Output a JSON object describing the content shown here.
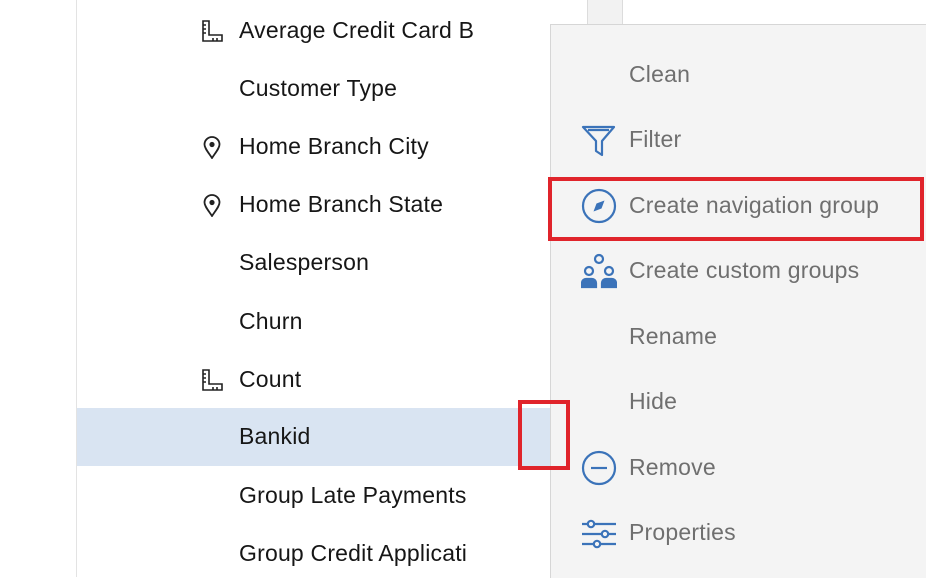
{
  "field_list": {
    "items": [
      {
        "label": "Average Credit Card B",
        "icon": "ruler-icon",
        "selected": false
      },
      {
        "label": "Customer Type",
        "icon": "",
        "selected": false
      },
      {
        "label": "Home Branch City",
        "icon": "location-pin-icon",
        "selected": false
      },
      {
        "label": "Home Branch State",
        "icon": "location-pin-icon",
        "selected": false
      },
      {
        "label": "Salesperson",
        "icon": "",
        "selected": false
      },
      {
        "label": "Churn",
        "icon": "",
        "selected": false
      },
      {
        "label": "Count",
        "icon": "ruler-icon",
        "selected": false
      },
      {
        "label": "Bankid",
        "icon": "",
        "selected": true
      },
      {
        "label": "Group Late Payments",
        "icon": "",
        "selected": false
      },
      {
        "label": "Group Credit Applicati",
        "icon": "",
        "selected": false
      }
    ]
  },
  "context_menu": {
    "items": [
      {
        "label": "Clean",
        "icon": ""
      },
      {
        "label": "Filter",
        "icon": "filter-icon"
      },
      {
        "label": "Create navigation group",
        "icon": "compass-icon"
      },
      {
        "label": "Create custom groups",
        "icon": "custom-groups-icon"
      },
      {
        "label": "Rename",
        "icon": ""
      },
      {
        "label": "Hide",
        "icon": ""
      },
      {
        "label": "Remove",
        "icon": "remove-icon"
      },
      {
        "label": "Properties",
        "icon": "properties-icon"
      }
    ]
  },
  "colors": {
    "accent": "#3b73b9",
    "selected_row": "#d9e4f2",
    "highlight": "#e0242b",
    "menu_text": "#6f6f6f"
  }
}
